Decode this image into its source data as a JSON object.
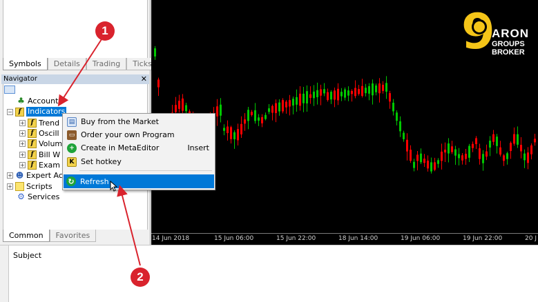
{
  "market_watch": {
    "tabs": [
      "Symbols",
      "Details",
      "Trading",
      "Ticks"
    ],
    "active_tab": 0
  },
  "navigator": {
    "title": "Navigator",
    "close_glyph": "✕",
    "root_icon": "navigator-root-icon",
    "items": [
      {
        "label": "Accounts",
        "icon": "accounts-icon"
      },
      {
        "label": "Indicators",
        "icon": "indicators-icon"
      },
      {
        "label": "Trend",
        "icon": "indicator-folder-icon"
      },
      {
        "label": "Oscill",
        "icon": "indicator-folder-icon"
      },
      {
        "label": "Volum",
        "icon": "indicator-folder-icon"
      },
      {
        "label": "Bill W",
        "icon": "indicator-folder-icon"
      },
      {
        "label": "Exam",
        "icon": "indicator-folder-icon"
      },
      {
        "label": "Expert Ac",
        "icon": "expert-advisors-icon"
      },
      {
        "label": "Scripts",
        "icon": "scripts-icon"
      },
      {
        "label": "Services",
        "icon": "services-icon"
      }
    ],
    "tabs": [
      "Common",
      "Favorites"
    ],
    "active_tab": 0
  },
  "context_menu": {
    "items": [
      {
        "label": "Buy from the Market",
        "icon": "market-icon",
        "shortcut": ""
      },
      {
        "label": "Order your own Program",
        "icon": "briefcase-icon",
        "shortcut": ""
      },
      {
        "label": "Create in MetaEditor",
        "icon": "add-icon",
        "shortcut": "Insert"
      },
      {
        "label": "Set hotkey",
        "icon": "hotkey-icon",
        "shortcut": ""
      },
      {
        "label": "Refresh",
        "icon": "refresh-icon",
        "shortcut": "",
        "highlighted": true
      }
    ]
  },
  "chart": {
    "time_labels": [
      "14 Jun 2018",
      "15 Jun 06:00",
      "15 Jun 22:00",
      "18 Jun 14:00",
      "19 Jun 06:00",
      "19 Jun 22:00",
      "20 J"
    ],
    "bull_color": "#00c800",
    "bear_color": "#ff0000"
  },
  "logo": {
    "digit": "9",
    "line1": "ARON",
    "line2": "GROUPS",
    "line3": "BROKER",
    "color": "#f5c518"
  },
  "terminal": {
    "subject_label": "Subject"
  },
  "annotations": {
    "badge1": "1",
    "badge2": "2",
    "color": "#d9232d"
  }
}
